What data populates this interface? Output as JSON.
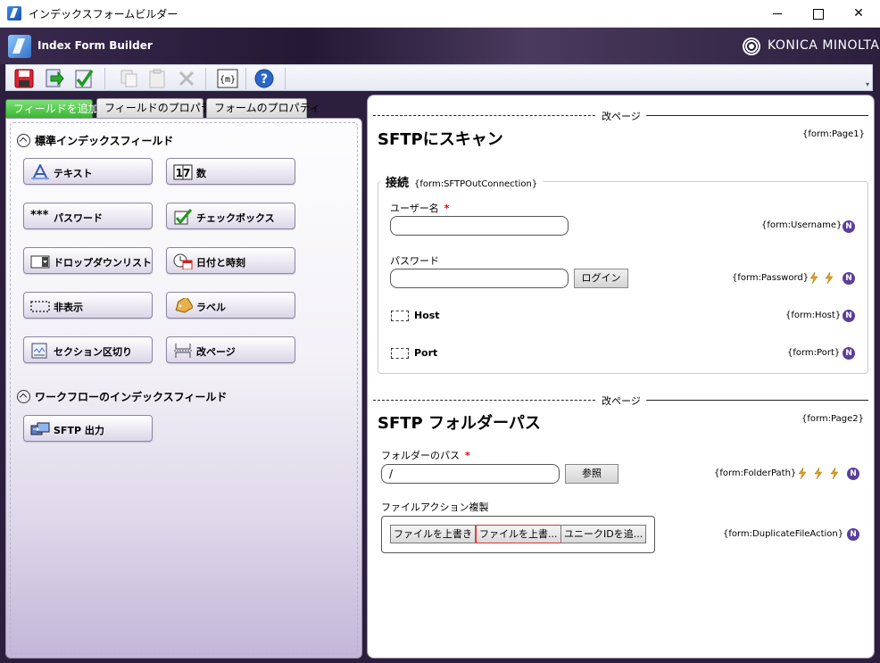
{
  "window": {
    "title": "インデックスフォームビルダー"
  },
  "banner": {
    "product": "Index Form Builder",
    "brand": "KONICA MINOLTA"
  },
  "toolbar": {
    "icons": [
      "save-icon",
      "import-icon",
      "validate-icon",
      "copy-icon",
      "paste-icon",
      "delete-icon",
      "variable-icon",
      "help-icon"
    ],
    "variable_glyph": "{m}",
    "help_glyph": "?"
  },
  "left": {
    "tabs": [
      "フィールドを追加",
      "フィールドのプロパティ",
      "フォームのプロパティ"
    ],
    "standard_section": "標準インデックスフィールド",
    "standard_fields": [
      {
        "label": "テキスト",
        "icon": "text-field-icon"
      },
      {
        "label": "数",
        "icon": "number-field-icon"
      },
      {
        "label": "パスワード",
        "icon": "password-field-icon"
      },
      {
        "label": "チェックボックス",
        "icon": "checkbox-field-icon"
      },
      {
        "label": "ドロップダウンリスト",
        "icon": "dropdown-field-icon"
      },
      {
        "label": "日付と時刻",
        "icon": "datetime-field-icon"
      },
      {
        "label": "非表示",
        "icon": "hidden-field-icon"
      },
      {
        "label": "ラベル",
        "icon": "label-field-icon"
      },
      {
        "label": "セクション区切り",
        "icon": "section-break-icon"
      },
      {
        "label": "改ページ",
        "icon": "page-break-icon"
      }
    ],
    "password_glyph": "***",
    "number_glyph": "17",
    "workflow_section": "ワークフローのインデックスフィールド",
    "workflow_fields": [
      {
        "label": "SFTP 出力",
        "icon": "sftp-output-icon"
      }
    ]
  },
  "right": {
    "page_break_label": "改ページ",
    "page1": {
      "title": "SFTPにスキャン",
      "tag": "{form:Page1}",
      "group": {
        "title": "接続",
        "tag": "{form:SFTPOutConnection}",
        "username_label": "ユーザー名",
        "username_tag": "{form:Username}",
        "password_label": "パスワード",
        "password_tag": "{form:Password}",
        "login_button": "ログイン",
        "host_label": "Host",
        "host_tag": "{form:Host}",
        "port_label": "Port",
        "port_tag": "{form:Port}"
      }
    },
    "page2": {
      "title": "SFTP フォルダーパス",
      "tag": "{form:Page2}",
      "folder_label": "フォルダーのパス",
      "folder_value": "/",
      "folder_tag": "{form:FolderPath}",
      "browse_button": "参照",
      "dup_label": "ファイルアクション複製",
      "dup_tag": "{form:DuplicateFileAction}",
      "dup_options": [
        "ファイルを上書き",
        "ファイルを上書...",
        "ユニークIDを追..."
      ]
    },
    "required_mark": "*",
    "badge_letter": "N"
  }
}
